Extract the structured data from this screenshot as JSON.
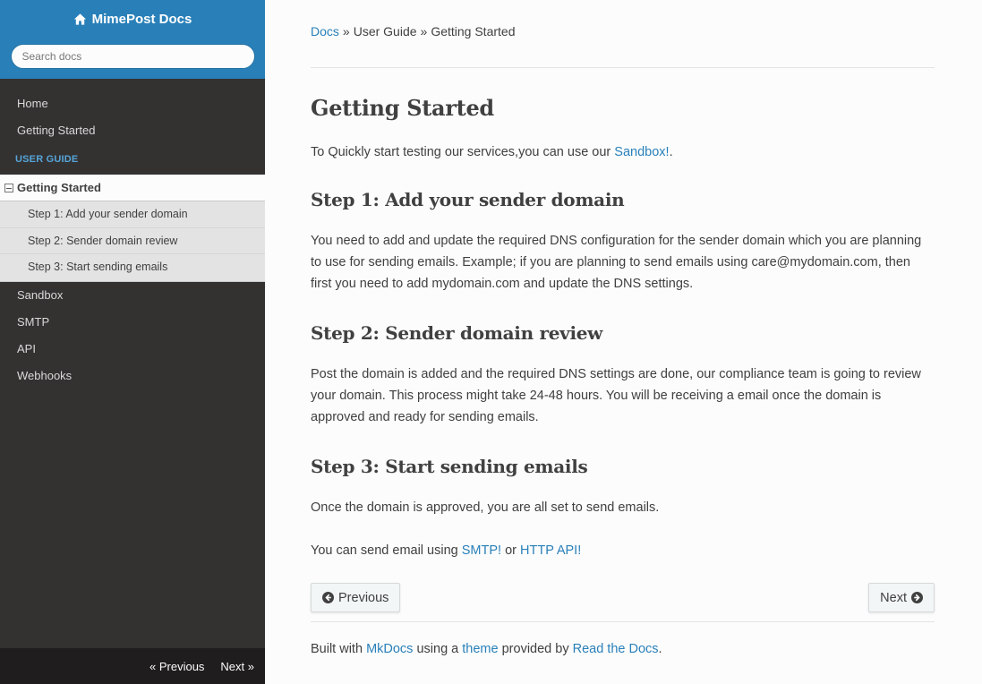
{
  "sidebar": {
    "brand": "MimePost Docs",
    "brand_icon": "home-icon",
    "search_placeholder": "Search docs",
    "items_top": [
      "Home",
      "Getting Started"
    ],
    "caption": "USER GUIDE",
    "current": "Getting Started",
    "sub_items": [
      "Step 1: Add your sender domain",
      "Step 2: Sender domain review",
      "Step 3: Start sending emails"
    ],
    "items_bottom": [
      "Sandbox",
      "SMTP",
      "API",
      "Webhooks"
    ],
    "versions": {
      "previous": "« Previous",
      "next": "Next »"
    }
  },
  "breadcrumbs": {
    "root": "Docs",
    "sep1": "»",
    "middle": "User Guide",
    "sep2": "»",
    "current": "Getting Started"
  },
  "main": {
    "title": "Getting Started",
    "intro_text": "To Quickly start testing our services,you can use our ",
    "intro_link": "Sandbox!",
    "intro_end": ".",
    "step1_title": "Step 1: Add your sender domain",
    "step1_text": "You need to add and update the required DNS configuration for the sender domain which you are planning to use for sending emails. Example; if you are planning to send emails using care@mydomain.com, then first you need to add mydomain.com and update the DNS settings.",
    "step2_title": "Step 2: Sender domain review",
    "step2_text": "Post the domain is added and the required DNS settings are done, our compliance team is going to review your domain. This process might take 24-48 hours. You will be receiving a email once the domain is approved and ready for sending emails.",
    "step3_title": "Step 3: Start sending emails",
    "step3_text": "Once the domain is approved, you are all set to send emails.",
    "send_text": "You can send email using ",
    "smtp_link": "SMTP!",
    "or_text": " or ",
    "http_link": "HTTP API!"
  },
  "nav_buttons": {
    "previous": "Previous",
    "next": "Next"
  },
  "footer": {
    "built_with": "Built with ",
    "mkdocs": "MkDocs",
    "using_a": " using a ",
    "theme": "theme",
    "provided_by": " provided by ",
    "rtd": "Read the Docs",
    "end": "."
  },
  "colors": {
    "accent": "#2980b9",
    "sidebar_bg": "#343131",
    "caption": "#55a5d9"
  }
}
